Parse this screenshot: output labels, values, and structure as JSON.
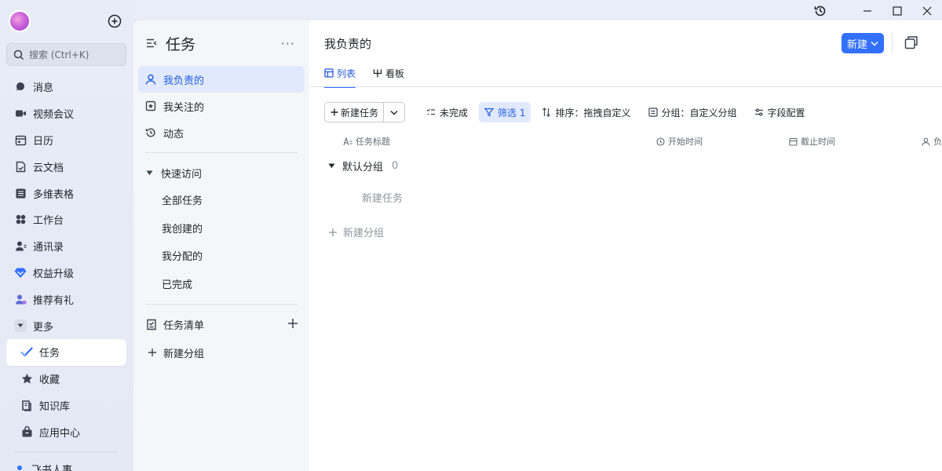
{
  "nav": {
    "search_placeholder": "搜索 (Ctrl+K)",
    "items": [
      {
        "label": "消息",
        "icon": "message-icon"
      },
      {
        "label": "视频会议",
        "icon": "video-icon"
      },
      {
        "label": "日历",
        "icon": "calendar-icon"
      },
      {
        "label": "云文档",
        "icon": "doc-icon"
      },
      {
        "label": "多维表格",
        "icon": "table-icon"
      },
      {
        "label": "工作台",
        "icon": "workbench-icon"
      },
      {
        "label": "通讯录",
        "icon": "contacts-icon"
      },
      {
        "label": "权益升级",
        "icon": "diamond-icon"
      },
      {
        "label": "推荐有礼",
        "icon": "gift-user-icon"
      },
      {
        "label": "更多",
        "icon": "caret-down-icon"
      },
      {
        "label": "任务",
        "icon": "task-check-icon"
      },
      {
        "label": "收藏",
        "icon": "star-icon"
      },
      {
        "label": "知识库",
        "icon": "library-icon"
      },
      {
        "label": "应用中心",
        "icon": "bag-icon"
      }
    ],
    "bottom_label": "飞书人事"
  },
  "mid": {
    "title": "任务",
    "items": [
      {
        "label": "我负责的"
      },
      {
        "label": "我关注的"
      },
      {
        "label": "动态"
      }
    ],
    "quick_access": "快速访问",
    "quick_items": [
      "全部任务",
      "我创建的",
      "我分配的",
      "已完成"
    ],
    "task_list": "任务清单",
    "new_group": "新建分组"
  },
  "main": {
    "title": "我负责的",
    "new_button": "新建",
    "tabs": [
      {
        "label": "列表"
      },
      {
        "label": "看板"
      }
    ],
    "toolbar": {
      "new_task": "新建任务",
      "uncompleted": "未完成",
      "filter": "筛选 1",
      "sort": "排序：拖拽自定义",
      "group": "分组：自定义分组",
      "fields": "字段配置"
    },
    "columns": {
      "title": "任务标题",
      "start": "开始时间",
      "due": "截止时间",
      "assignee": "负"
    },
    "group": {
      "name": "默认分组",
      "count": "0"
    },
    "new_task_row": "新建任务",
    "new_group": "新建分组"
  },
  "colors": {
    "accent": "#3370ff",
    "accent_text": "#245bdb",
    "active_bg": "#e0e9ff"
  }
}
